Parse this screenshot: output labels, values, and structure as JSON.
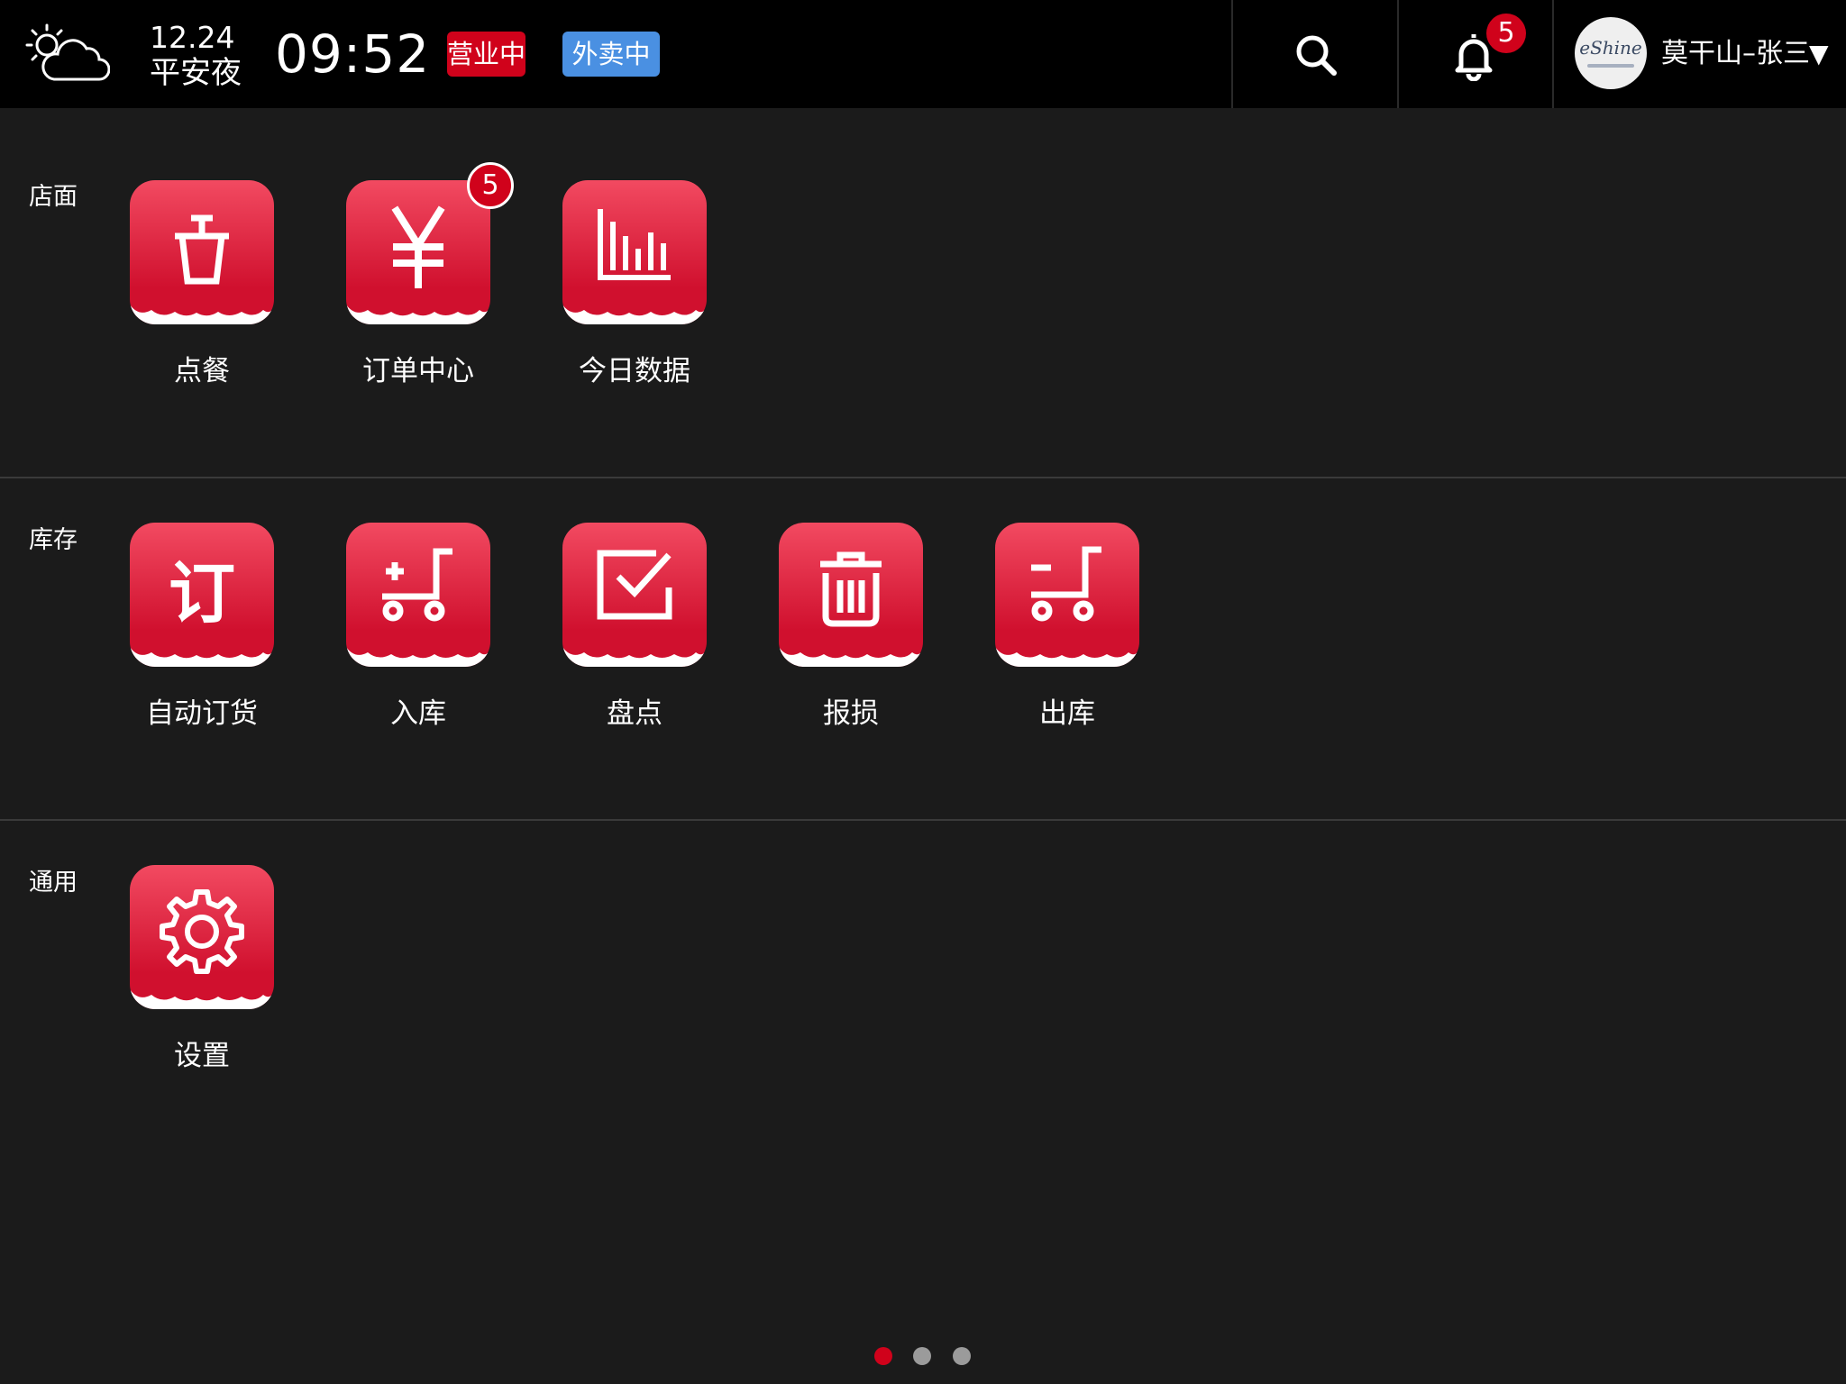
{
  "header": {
    "weather_icon": "partly-cloudy-icon",
    "date": "12.24",
    "holiday": "平安夜",
    "time": "09:52",
    "status_open": "营业中",
    "status_delivery": "外卖中",
    "notification_count": "5",
    "avatar_text": "eShine",
    "user_name": "莫干山–张三",
    "user_caret": "▼",
    "colors": {
      "open": "#d0021b",
      "delivery": "#4a90e2"
    }
  },
  "sections": [
    {
      "label": "店面",
      "apps": [
        {
          "label": "点餐",
          "icon": "cup-icon"
        },
        {
          "label": "订单中心",
          "icon": "yen-icon",
          "badge": "5"
        },
        {
          "label": "今日数据",
          "icon": "bar-chart-icon"
        }
      ]
    },
    {
      "label": "库存",
      "apps": [
        {
          "label": "自动订货",
          "icon": "order-char-icon",
          "glyph_text": "订"
        },
        {
          "label": "入库",
          "icon": "cart-add-icon"
        },
        {
          "label": "盘点",
          "icon": "checkbox-icon"
        },
        {
          "label": "报损",
          "icon": "trash-icon"
        },
        {
          "label": "出库",
          "icon": "cart-remove-icon"
        }
      ]
    },
    {
      "label": "通用",
      "apps": [
        {
          "label": "设置",
          "icon": "gear-icon"
        }
      ]
    }
  ],
  "pager": {
    "pages": 3,
    "current": 1,
    "active_color": "#d0021b",
    "inactive_color": "#9b9b9b"
  }
}
